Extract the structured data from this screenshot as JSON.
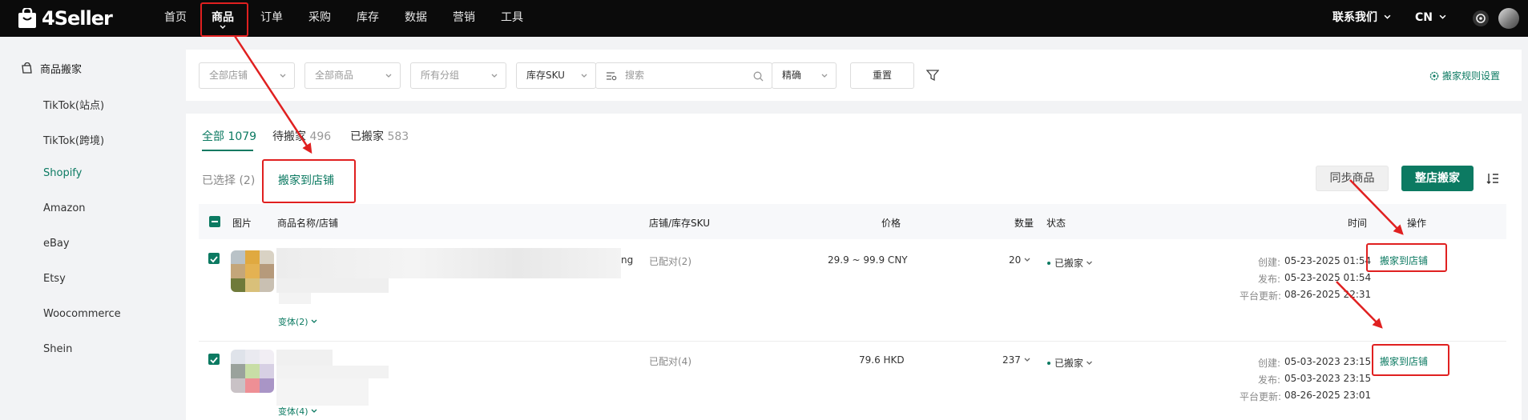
{
  "brand": "4Seller",
  "nav": [
    "首页",
    "商品",
    "订单",
    "采购",
    "库存",
    "数据",
    "营销",
    "工具"
  ],
  "top_right": {
    "contact": "联系我们",
    "lang": "CN"
  },
  "sidebar": {
    "title": "商品搬家",
    "items": [
      "TikTok(站点)",
      "TikTok(跨境)",
      "Shopify",
      "Amazon",
      "eBay",
      "Etsy",
      "Woocommerce",
      "Shein"
    ]
  },
  "filters": {
    "store": "全部店铺",
    "product": "全部商品",
    "group": "所有分组",
    "sku_type": "库存SKU",
    "search_placeholder": "搜索",
    "match": "精确",
    "reset": "重置",
    "rules": "搬家规则设置"
  },
  "tabs": [
    {
      "label": "全部",
      "count": "1079"
    },
    {
      "label": "待搬家",
      "count": "496"
    },
    {
      "label": "已搬家",
      "count": "583"
    }
  ],
  "actions": {
    "selected": "已选择 (2)",
    "move_to_store": "搬家到店铺",
    "sync": "同步商品",
    "move_all": "整店搬家"
  },
  "columns": [
    "图片",
    "商品名称/店铺",
    "店铺/库存SKU",
    "价格",
    "数量",
    "状态",
    "时间",
    "操作"
  ],
  "rows": [
    {
      "name_tail": "ng",
      "variant": "变体(2)",
      "matched": "已配对(2)",
      "price": "29.9 ~ 99.9 CNY",
      "qty": "20",
      "status": "已搬家",
      "created_label": "创建:",
      "created": "05-23-2025 01:54",
      "published_label": "发布:",
      "published": "05-23-2025 01:54",
      "updated_label": "平台更新:",
      "updated": "08-26-2025 22:31",
      "action": "搬家到店铺"
    },
    {
      "name_tail": "",
      "variant": "变体(4)",
      "matched": "已配对(4)",
      "price": "79.6 HKD",
      "qty": "237",
      "status": "已搬家",
      "created_label": "创建:",
      "created": "05-03-2023 23:15",
      "published_label": "发布:",
      "published": "05-03-2023 23:15",
      "updated_label": "平台更新:",
      "updated": "08-26-2025 23:01",
      "action": "搬家到店铺"
    }
  ],
  "colors": {
    "accent": "#0c7a62",
    "annotation": "#e02020",
    "topbar": "#0b0b0b"
  }
}
